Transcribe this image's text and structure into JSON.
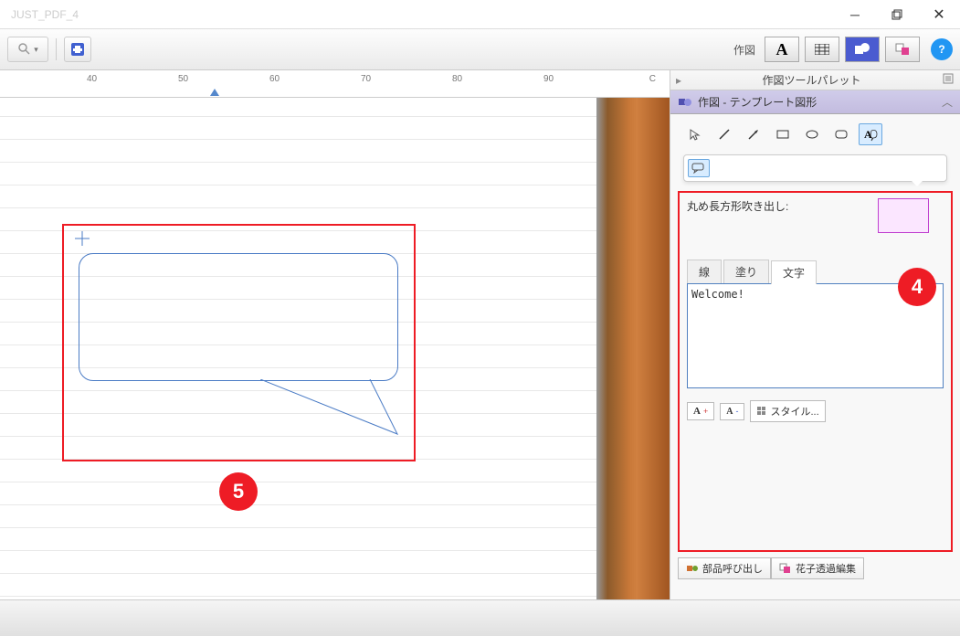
{
  "window": {
    "title": "JUST_PDF_4"
  },
  "toolbar": {
    "label": "作図",
    "help": "?"
  },
  "ruler": {
    "ticks": [
      {
        "pos": 0,
        "label": ""
      },
      {
        "pos": 100,
        "label": "40"
      },
      {
        "pos": 200,
        "label": "50"
      },
      {
        "pos": 300,
        "label": "60"
      },
      {
        "pos": 400,
        "label": "70"
      },
      {
        "pos": 500,
        "label": "80"
      },
      {
        "pos": 600,
        "label": "90"
      }
    ],
    "edge_label": "C"
  },
  "annotations": {
    "four": "4",
    "five": "5"
  },
  "palette": {
    "title": "作図ツールパレット",
    "section": "作図 - テンプレート図形",
    "shape_label": "丸め長方形吹き出し:",
    "tabs": {
      "line": "線",
      "fill": "塗り",
      "text": "文字"
    },
    "text_value": "Welcome!",
    "font_larger": "A",
    "font_larger_sup": "+",
    "font_smaller": "A",
    "font_smaller_sup": "-",
    "style_btn": "スタイル...",
    "bottom_tabs": {
      "parts": "部品呼び出し",
      "hanako": "花子透過編集"
    }
  }
}
